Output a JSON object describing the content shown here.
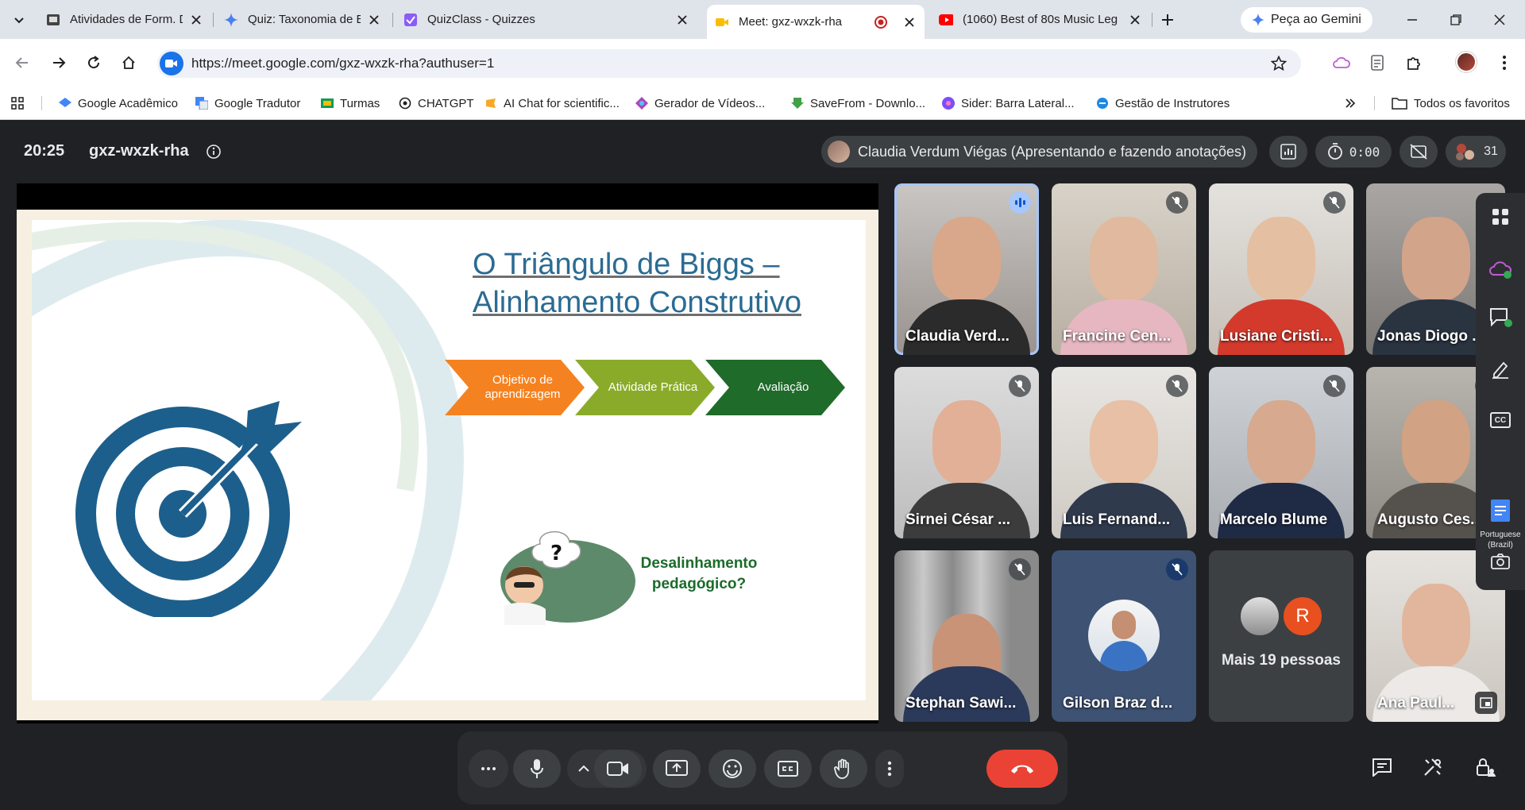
{
  "browser": {
    "tabs": [
      {
        "title": "Atividades de Form. Docente",
        "icon": "classroom-icon",
        "active": false
      },
      {
        "title": "Quiz: Taxonomia de Bloom e",
        "icon": "gemini-star-icon",
        "active": false
      },
      {
        "title": "QuizClass - Quizzes",
        "icon": "quizclass-icon",
        "active": false
      },
      {
        "title": "Meet: gxz-wxzk-rha",
        "icon": "meet-icon",
        "active": true
      },
      {
        "title": "(1060) Best of 80s Music Leg",
        "icon": "youtube-icon",
        "active": false
      }
    ],
    "gemini_button": "Peça ao Gemini",
    "url": "https://meet.google.com/gxz-wxzk-rha?authuser=1",
    "bookmarks": [
      {
        "label": "Google Acadêmico",
        "icon": "scholar-icon"
      },
      {
        "label": "Google Tradutor",
        "icon": "translate-icon"
      },
      {
        "label": "Turmas",
        "icon": "classroom-icon"
      },
      {
        "label": "CHATGPT",
        "icon": "openai-icon"
      },
      {
        "label": "AI Chat for scientific...",
        "icon": "scispace-icon"
      },
      {
        "label": "Gerador de Vídeos...",
        "icon": "video-gen-icon"
      },
      {
        "label": "SaveFrom - Downlo...",
        "icon": "savefrom-icon"
      },
      {
        "label": "Sider: Barra Lateral...",
        "icon": "sider-icon"
      },
      {
        "label": "Gestão de Instrutores",
        "icon": "gestao-icon"
      }
    ],
    "all_bookmarks": "Todos os favoritos"
  },
  "meet": {
    "time": "20:25",
    "code": "gxz-wxzk-rha",
    "presenter": "Claudia Verdum Viégas (Apresentando e fazendo anotações)",
    "timer": "0:00",
    "participant_count": "31",
    "slide": {
      "title_line1": "O Triângulo de Biggs –",
      "title_line2": "Alinhamento Construtivo",
      "steps": [
        {
          "label": "Objetivo de aprendizagem",
          "color": "#f58220"
        },
        {
          "label": "Atividade Prática",
          "color": "#8aab2a"
        },
        {
          "label": "Avaliação",
          "color": "#1f6b2a"
        }
      ],
      "callout": "Desalinhamento pedagógico?",
      "question_mark": "?"
    },
    "tiles": [
      {
        "name": "Claudia Verd...",
        "state": "speaking"
      },
      {
        "name": "Francine Cen...",
        "state": "muted"
      },
      {
        "name": "Lusiane Cristi...",
        "state": "muted"
      },
      {
        "name": "Jonas Diogo ...",
        "state": "muted"
      },
      {
        "name": "Sirnei César ...",
        "state": "muted"
      },
      {
        "name": "Luis Fernand...",
        "state": "muted"
      },
      {
        "name": "Marcelo Blume",
        "state": "muted"
      },
      {
        "name": "Augusto Ces...",
        "state": "none"
      },
      {
        "name": "Stephan Sawi...",
        "state": "muted"
      },
      {
        "name": "Gilson Braz d...",
        "state": "muted"
      },
      {
        "name": "Mais 19 pessoas",
        "state": "more",
        "avatar_letter": "R"
      },
      {
        "name": "Ana Paul...",
        "state": "none"
      }
    ],
    "caption_language": "Portuguese (Brazil)",
    "cc_label": "CC"
  },
  "colors": {
    "meet_bg": "#202124",
    "leave_red": "#ea4335",
    "speaking_blue": "#a8c7fa",
    "slide_title": "#2b6b93",
    "target_blue": "#1d5f8c"
  }
}
